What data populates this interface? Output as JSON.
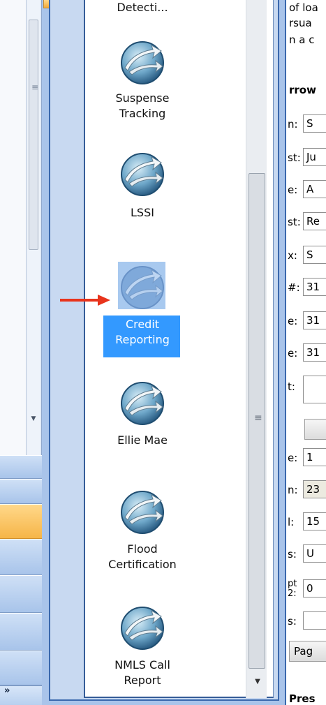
{
  "left_nav": {
    "overflow_chevron": "»"
  },
  "tools": {
    "partial_top_label": "Detecti...",
    "items": [
      {
        "name": "suspense-tracking",
        "label_line1": "Suspense",
        "label_line2": "Tracking"
      },
      {
        "name": "lssi",
        "label_line1": "LSSI",
        "label_line2": ""
      },
      {
        "name": "credit-reporting",
        "label_line1": "Credit",
        "label_line2": "Reporting",
        "selected": true
      },
      {
        "name": "ellie-mae",
        "label_line1": "Ellie Mae",
        "label_line2": ""
      },
      {
        "name": "flood-certification",
        "label_line1": "Flood",
        "label_line2": "Certification"
      },
      {
        "name": "nmls-call-report",
        "label_line1": "NMLS Call",
        "label_line2": "Report"
      }
    ]
  },
  "form": {
    "top_text": [
      "of loa",
      "rsua",
      "n a c"
    ],
    "section_header": "rrow",
    "rows": [
      {
        "label": "n:",
        "value": "S"
      },
      {
        "label": "st:",
        "value": "Ju"
      },
      {
        "label": "e:",
        "value": "A"
      },
      {
        "label": "st:",
        "value": "Re"
      },
      {
        "label": "x:",
        "value": "S"
      },
      {
        "label": "#:",
        "value": "31"
      },
      {
        "label": "e:",
        "value": "31"
      },
      {
        "label": "e:",
        "value": "31"
      },
      {
        "label": "t:",
        "value": ""
      },
      {
        "label": "e:",
        "value": "1"
      },
      {
        "label": "n:",
        "value": "23"
      },
      {
        "label": "l:",
        "value": "15"
      },
      {
        "label": "s:",
        "value": "U"
      },
      {
        "label": "pt 2:",
        "value": "0"
      },
      {
        "label": "s:",
        "value": ""
      }
    ],
    "page_button": "Pag",
    "bottom_header": "Pres"
  },
  "colors": {
    "selection": "#3399ff",
    "arrow": "#e8341c",
    "frame_blue": "#3a68ad"
  }
}
